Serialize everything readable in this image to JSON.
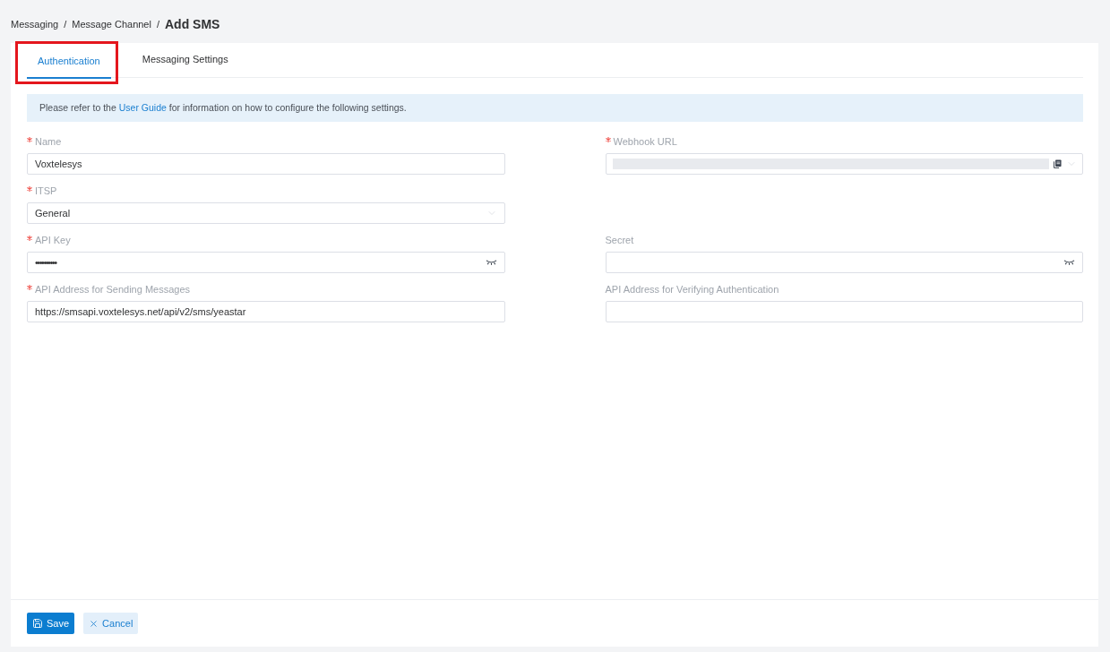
{
  "breadcrumb": [
    {
      "label": "Messaging",
      "kind": "link"
    },
    {
      "label": "/",
      "kind": "separator"
    },
    {
      "label": "Message Channel",
      "kind": "link"
    },
    {
      "label": "/",
      "kind": "separator"
    },
    {
      "label": "Add SMS",
      "kind": "current"
    }
  ],
  "tabs": [
    {
      "label": "Authentication",
      "selected": true,
      "highlighted": true
    },
    {
      "label": "Messaging Settings",
      "selected": false,
      "highlighted": false
    }
  ],
  "info_banner": {
    "text_before": "Please refer to the ",
    "link": "User Guide",
    "text_after": " for information on how to configure the following settings."
  },
  "form": {
    "rows": [
      {
        "fields": [
          {
            "label": "Name",
            "required": true,
            "kind": "text",
            "value": "Voxtelesys"
          },
          {
            "label": "Webhook URL",
            "required": true,
            "kind": "copy",
            "redacted": true
          }
        ]
      },
      {
        "fields": [
          {
            "label": "ITSP",
            "required": true,
            "kind": "select",
            "value": "General"
          }
        ]
      },
      {
        "fields": [
          {
            "label": "API Key",
            "required": true,
            "kind": "password",
            "value": "••••••••••"
          },
          {
            "label": "Secret",
            "required": false,
            "kind": "password"
          }
        ]
      },
      {
        "fields": [
          {
            "label": "API Address for Sending Messages",
            "required": true,
            "kind": "text",
            "value": "https://smsapi.voxtelesys.net/api/v2/sms/yeastar"
          },
          {
            "label": "API Address for Verifying Authentication",
            "required": false,
            "kind": "text"
          }
        ]
      }
    ]
  },
  "buttons": [
    {
      "label": "Save",
      "kind": "primary"
    },
    {
      "label": "Cancel",
      "kind": "secondary"
    }
  ]
}
